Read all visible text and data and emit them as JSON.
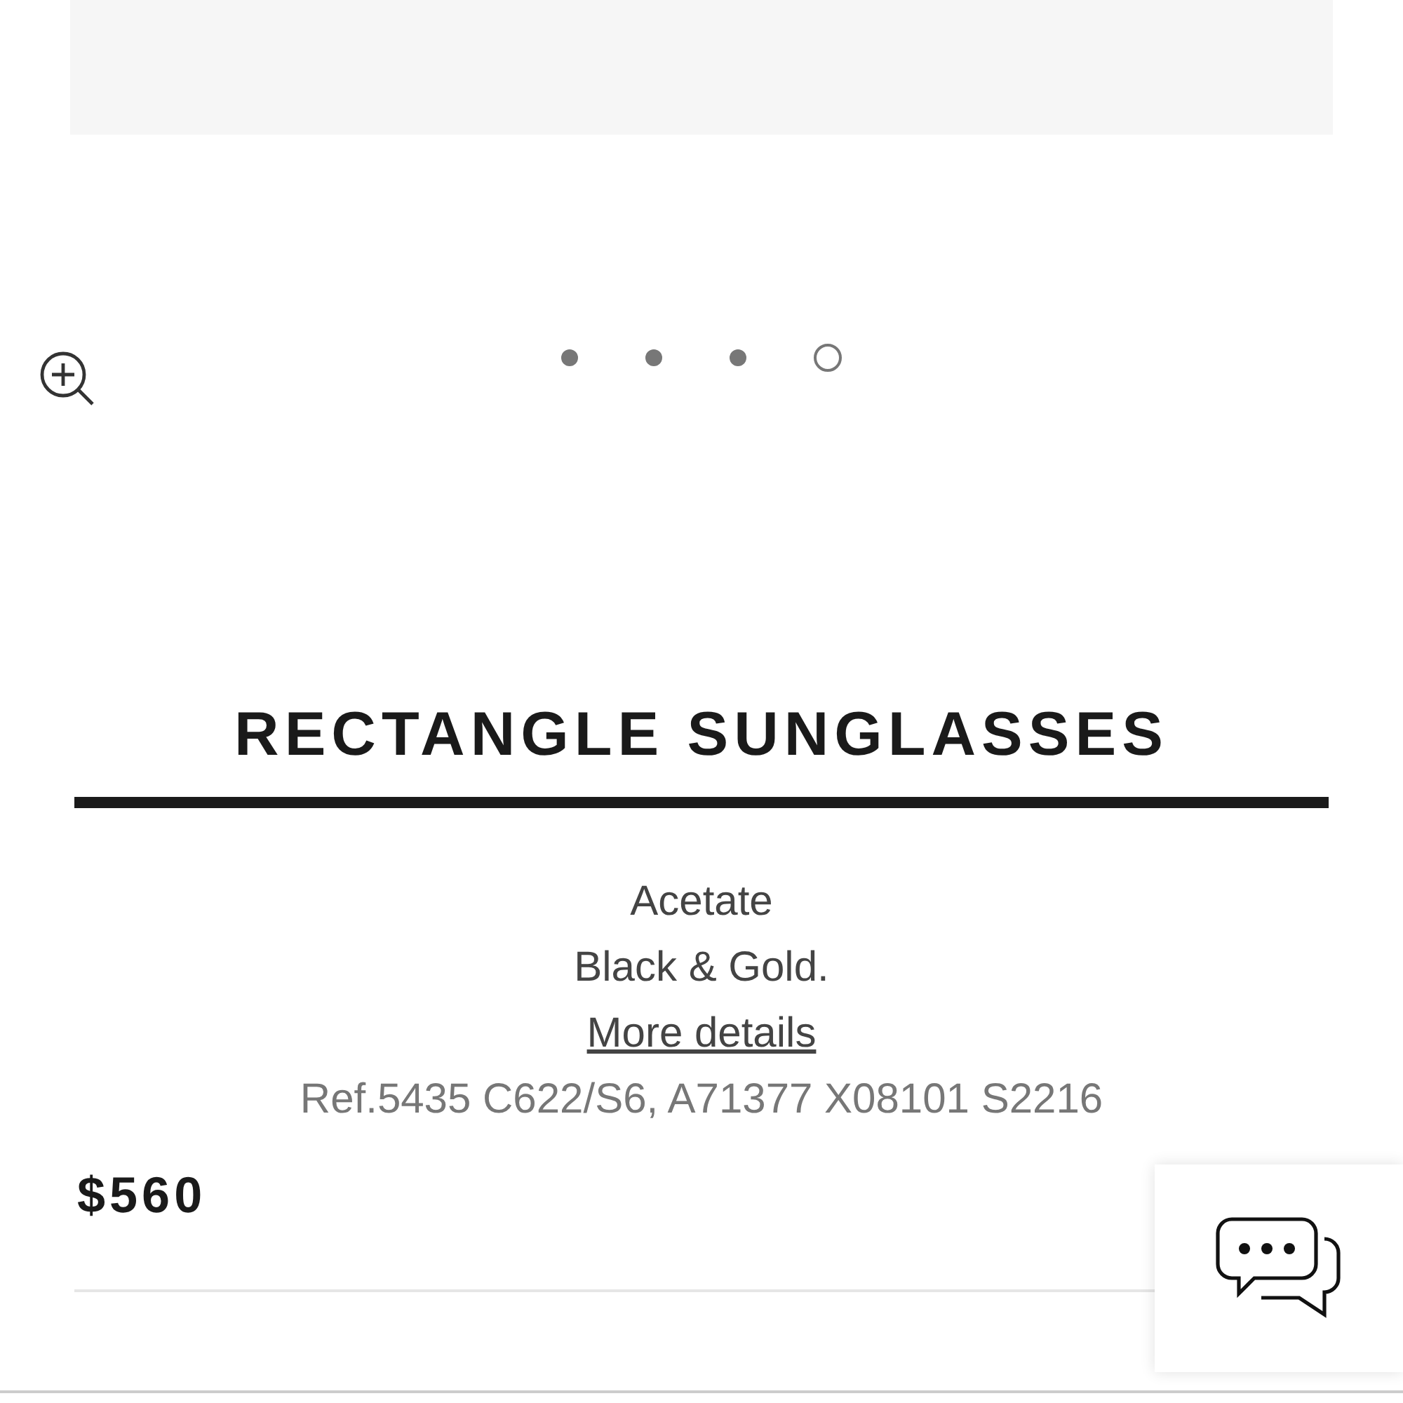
{
  "carousel": {
    "dots": [
      {
        "selected": false
      },
      {
        "selected": false
      },
      {
        "selected": false
      },
      {
        "selected": true
      }
    ]
  },
  "product": {
    "title": "RECTANGLE SUNGLASSES",
    "material": "Acetate",
    "finish": "Black & Gold.",
    "details_link": "More details",
    "reference": "Ref.5435 C622/S6, A71377 X08101 S2216",
    "price": "$560"
  }
}
